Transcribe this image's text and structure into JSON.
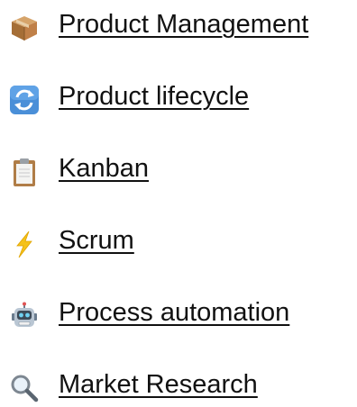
{
  "links": [
    {
      "label": "Product Management",
      "icon": "package-icon"
    },
    {
      "label": "Product lifecycle",
      "icon": "refresh-cycle-icon"
    },
    {
      "label": "Kanban",
      "icon": "clipboard-icon"
    },
    {
      "label": "Scrum",
      "icon": "lightning-icon"
    },
    {
      "label": "Process automation",
      "icon": "robot-icon"
    },
    {
      "label": "Market Research",
      "icon": "magnifier-icon"
    }
  ],
  "colors": {
    "text": "#111111",
    "background": "#ffffff",
    "box": "#b8834a",
    "cycle": "#4a8fd8",
    "clipboard": "#c9995c",
    "lightning": "#f5c21a",
    "robot": "#7a8fa3"
  }
}
